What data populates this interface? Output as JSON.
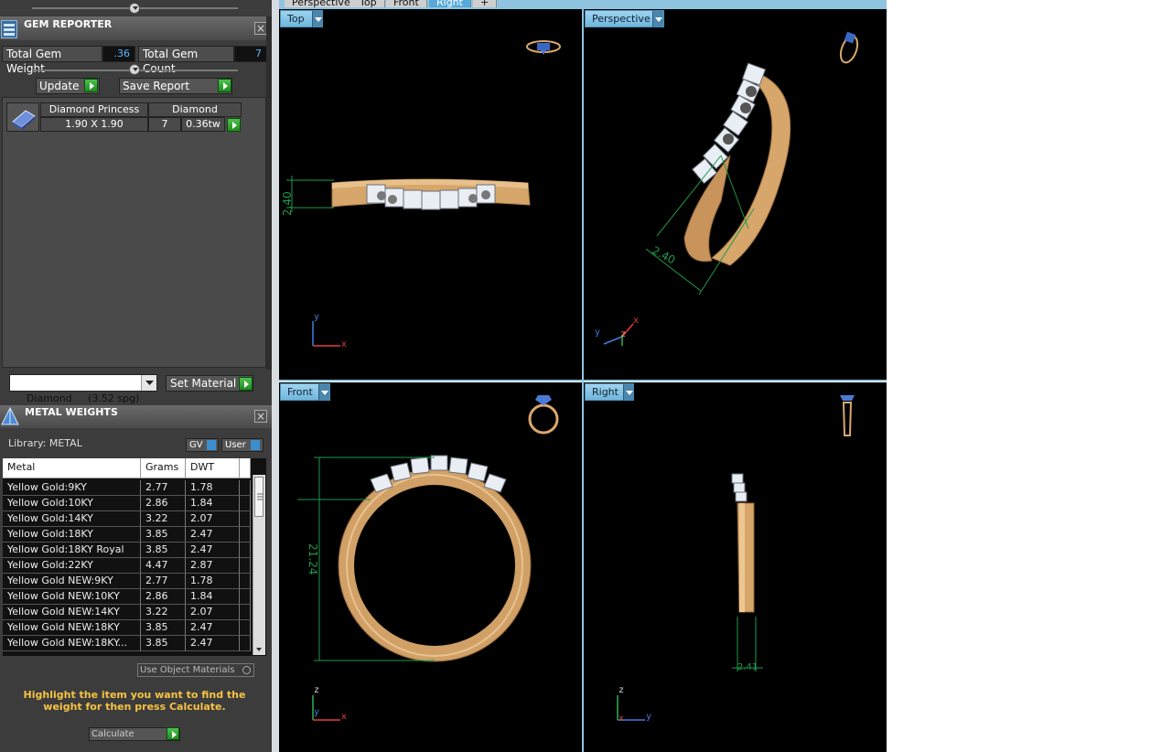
{
  "gem_reporter": {
    "title": "GEM REPORTER",
    "total_weight_label": "Total Gem Weight",
    "total_weight_value": ".36",
    "total_count_label": "Total Gem Count",
    "total_count_value": "7",
    "update_label": "Update",
    "save_report_label": "Save Report",
    "gem_row": {
      "name": "Diamond Princess",
      "material": "Diamond",
      "size": "1.90 X 1.90",
      "count": "7",
      "weight": "0.36tw"
    }
  },
  "material_select": {
    "value": "Diamond     (3.52 spg)",
    "set_material_label": "Set Material"
  },
  "metal_weights": {
    "title": "METAL WEIGHTS",
    "library_label": "Library: METAL",
    "gv_label": "GV",
    "user_label": "User",
    "columns": [
      "Metal",
      "Grams",
      "DWT"
    ],
    "rows": [
      [
        "Yellow Gold:9KY",
        "2.77",
        "1.78"
      ],
      [
        "Yellow Gold:10KY",
        "2.86",
        "1.84"
      ],
      [
        "Yellow Gold:14KY",
        "3.22",
        "2.07"
      ],
      [
        "Yellow Gold:18KY",
        "3.85",
        "2.47"
      ],
      [
        "Yellow Gold:18KY Royal",
        "3.85",
        "2.47"
      ],
      [
        "Yellow Gold:22KY",
        "4.47",
        "2.87"
      ],
      [
        "Yellow Gold NEW:9KY",
        "2.77",
        "1.78"
      ],
      [
        "Yellow Gold NEW:10KY",
        "2.86",
        "1.84"
      ],
      [
        "Yellow Gold NEW:14KY",
        "3.22",
        "2.07"
      ],
      [
        "Yellow Gold NEW:18KY",
        "3.85",
        "2.47"
      ],
      [
        "Yellow Gold NEW:18KY...",
        "3.85",
        "2.47"
      ]
    ],
    "use_object_materials_label": "Use Object Materials",
    "hint": "Highlight the item you want to find the weight for then press Calculate.",
    "calculate_label": "Calculate"
  },
  "top_tabs": [
    "Perspective",
    "Top",
    "Front",
    "Right"
  ],
  "viewports": {
    "top": {
      "label": "Top",
      "dimension": "2.40",
      "axes": [
        "y",
        "x"
      ]
    },
    "perspective": {
      "label": "Perspective",
      "dimension": "2.40",
      "axes": [
        "y",
        "z",
        "x"
      ]
    },
    "front": {
      "label": "Front",
      "dimension": "21.24",
      "axes": [
        "z",
        "y",
        "x"
      ]
    },
    "right": {
      "label": "Right",
      "dimension": "2.41",
      "axes": [
        "z",
        "x",
        "y"
      ]
    }
  },
  "colors": {
    "gold": "#d9a86c",
    "gem": "#e9eef5",
    "dimension": "#1e9a4a",
    "axis_x": "#e83c3c",
    "axis_y": "#3d7fe0",
    "tab_blue": "#8ccbea",
    "hint_yellow": "#f6c343"
  }
}
